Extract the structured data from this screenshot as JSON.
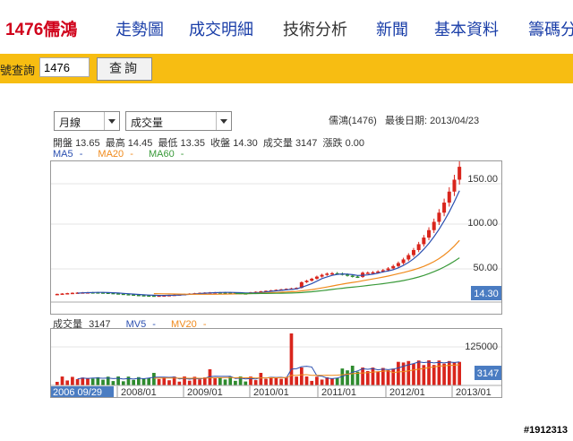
{
  "nav": {
    "brand": "1476儒鴻",
    "items": [
      "走勢圖",
      "成交明細",
      "技術分析",
      "新聞",
      "基本資料",
      "籌碼分"
    ],
    "active_index": 2
  },
  "query": {
    "label": "號查詢",
    "value": "1476",
    "button": "查詢"
  },
  "controls": {
    "period": "月線",
    "indicator": "成交量"
  },
  "header": {
    "stock": "儒鴻(1476)",
    "last_date_label": "最後日期:",
    "last_date": "2013/04/23"
  },
  "ohlc": {
    "open_label": "開盤",
    "open": "13.65",
    "high_label": "最高",
    "high": "14.45",
    "low_label": "最低",
    "low": "13.35",
    "close_label": "收盤",
    "close": "14.30",
    "vol_label": "成交量",
    "vol": "3147",
    "chg_label": "漲跌",
    "chg": "0.00"
  },
  "ma_legend": [
    {
      "label": "MA5",
      "value": "-",
      "color": "#2b4fb0"
    },
    {
      "label": "MA20",
      "value": "-",
      "color": "#f08a1c"
    },
    {
      "label": "MA60",
      "value": "-",
      "color": "#3a9a3a"
    }
  ],
  "vol_legend": [
    {
      "label": "成交量",
      "value": "3147",
      "color": "#333"
    },
    {
      "label": "MV5",
      "value": "-",
      "color": "#2b4fb0"
    },
    {
      "label": "MV20",
      "value": "-",
      "color": "#f08a1c"
    }
  ],
  "price_axis": {
    "ticks": [
      "150.00",
      "100.00",
      "50.00"
    ],
    "current": "14.30"
  },
  "volume_axis": {
    "ticks": [
      "125000"
    ],
    "current": "3147"
  },
  "time_axis": {
    "start": "2006 09/29",
    "labels": [
      "2008/01",
      "2009/01",
      "2010/01",
      "2011/01",
      "2012/01",
      "2013/01"
    ]
  },
  "colors": {
    "up": "#d9251c",
    "down": "#2e8b2e",
    "badge": "#4a7cc2",
    "accent": "#f7bd12"
  },
  "watermark": "#1912313"
}
